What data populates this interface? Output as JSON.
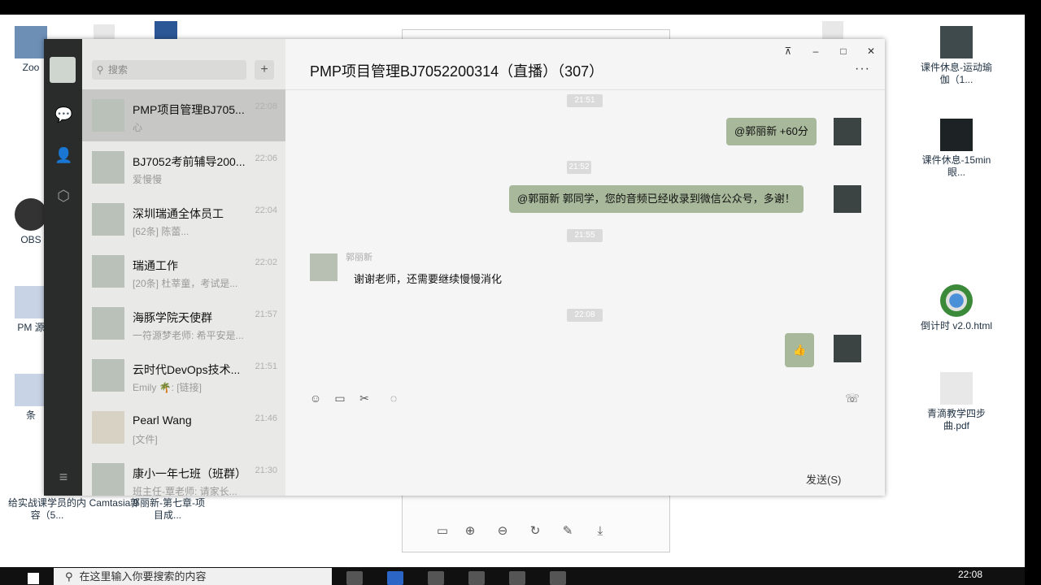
{
  "desktop": {
    "icons": [
      {
        "label": "Zoo",
        "icon": "zoom-app-icon"
      },
      {
        "label": "OBS",
        "icon": "obs-app-icon"
      },
      {
        "label": "PM 源",
        "icon": "document-icon"
      },
      {
        "label": "条",
        "icon": "document-icon"
      },
      {
        "label": "课件休息-运动瑜伽（1...",
        "icon": "video-file-icon"
      },
      {
        "label": "课件休息-15min眼...",
        "icon": "video-file-icon"
      },
      {
        "label": "倒计时 v2.0.html",
        "icon": "chrome-icon"
      },
      {
        "label": "青滴教学四步曲.pdf",
        "icon": "pdf-icon"
      },
      {
        "label": "给实战课学员的内容（5...",
        "icon": "folder-icon"
      },
      {
        "label": "Camtasia 9",
        "icon": "camtasia-icon"
      },
      {
        "label": "郭丽新-第七章-项目成...",
        "icon": "document-icon"
      }
    ]
  },
  "taskbar": {
    "search_placeholder": "在这里输入你要搜索的内容",
    "time": "22:08"
  },
  "wechat": {
    "search_placeholder": "搜索",
    "add_button": "+",
    "chats": [
      {
        "name": "PMP项目管理BJ705...",
        "time": "22:08",
        "preview": "心",
        "active": true
      },
      {
        "name": "BJ7052考前辅导200...",
        "time": "22:06",
        "preview": "爱慢慢",
        "active": false
      },
      {
        "name": "深圳瑞通全体员工",
        "time": "22:04",
        "preview": "[62条] 陈蕾...",
        "active": false
      },
      {
        "name": "瑞通工作",
        "time": "22:02",
        "preview": "[20条] 杜莘童，考试是...",
        "active": false
      },
      {
        "name": "海豚学院天使群",
        "time": "21:57",
        "preview": "一符源梦老师: 希平安是...",
        "active": false
      },
      {
        "name": "云时代DevOps技术...",
        "time": "21:51",
        "preview": "Emily 🌴: [链接]",
        "active": false
      },
      {
        "name": "Pearl Wang",
        "time": "21:46",
        "preview": "[文件]",
        "active": false
      },
      {
        "name": "康小一年七班（班群）",
        "time": "21:30",
        "preview": "班主任-覃老师: 请家长...",
        "active": false
      }
    ],
    "conversation": {
      "title": "PMP项目管理BJ7052200314（直播）（307）",
      "more": "···",
      "timestamps": [
        "21:51",
        "21:52",
        "21:55",
        "22:08"
      ],
      "messages": [
        {
          "from": "self",
          "text": "@郭丽新 +60分"
        },
        {
          "from": "self",
          "text": "@郭丽新 郭同学，您的音频已经收录到微信公众号，多谢！"
        },
        {
          "from": "other",
          "sender": "郭丽新",
          "text": "谢谢老师，还需要继续慢慢消化"
        },
        {
          "from": "self",
          "text": "👍"
        }
      ],
      "send_label": "发送(S)"
    }
  }
}
